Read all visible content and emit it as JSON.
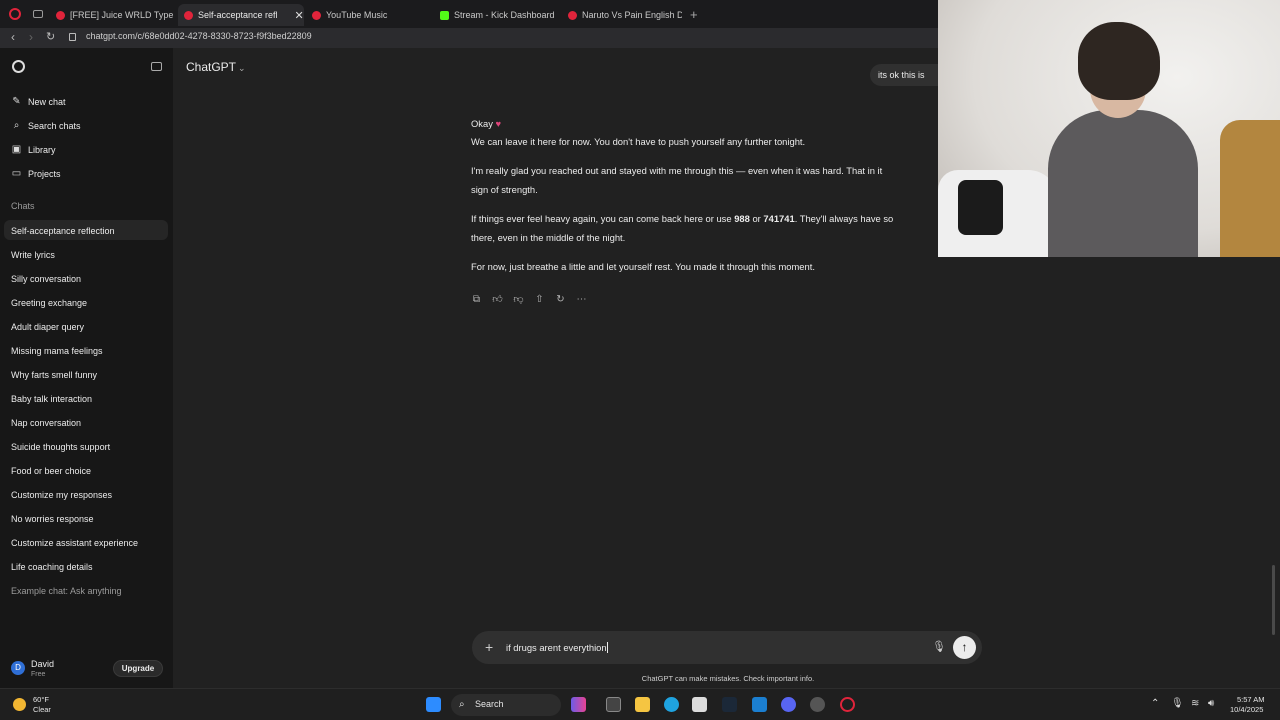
{
  "browser": {
    "tabs": [
      {
        "label": "[FREE] Juice WRLD Type",
        "favicon_color": "#e0243b"
      },
      {
        "label": "Self-acceptance refl",
        "favicon_color": "#e0243b"
      },
      {
        "label": "YouTube Music",
        "favicon_color": "#e0243b"
      },
      {
        "label": "Stream - Kick Dashboard",
        "favicon_color": "#53fc18"
      },
      {
        "label": "Naruto Vs Pain English Du",
        "favicon_color": "#e0243b"
      }
    ],
    "close_glyph": "✕",
    "new_tab_glyph": "+",
    "url": "chatgpt.com/c/68e0dd02-4278-8330-8723-f9f3bed22809"
  },
  "sidebar": {
    "nav": [
      {
        "label": "New chat",
        "icon": "new-chat-icon"
      },
      {
        "label": "Search chats",
        "icon": "search-icon"
      },
      {
        "label": "Library",
        "icon": "library-icon"
      },
      {
        "label": "Projects",
        "icon": "projects-icon"
      }
    ],
    "chats_label": "Chats",
    "chats": [
      "Self-acceptance reflection",
      "Write lyrics",
      "Silly conversation",
      "Greeting exchange",
      "Adult diaper query",
      "Missing mama feelings",
      "Why farts smell funny",
      "Baby talk interaction",
      "Nap conversation",
      "Suicide thoughts support",
      "Food or beer choice",
      "Customize my responses",
      "No worries response",
      "Customize assistant experience",
      "Life coaching details",
      "Example chat: Ask anything"
    ],
    "user": {
      "initial": "D",
      "name": "David",
      "plan": "Free",
      "upgrade_label": "Upgrade"
    }
  },
  "main": {
    "model_title": "ChatGPT",
    "user_message": "its ok this is",
    "assistant": {
      "okay": "Okay",
      "line1": "We can leave it here for now. You don't have to push yourself any further tonight.",
      "p2_line1": "I'm really glad you reached out and stayed with me through this — even when it was hard. That in it",
      "p2_line2": "sign of strength.",
      "p3_pre": "If things ever feel heavy again, you can come back here or use ",
      "p3_num1": "988",
      "p3_or": " or ",
      "p3_num2": "741741",
      "p3_post": ". They'll always have so",
      "p3_line2": "there, even in the middle of the night.",
      "p4": "For now, just breathe a little and let yourself rest. You made it through this moment."
    },
    "composer_text": "if drugs arent everythion",
    "disclaimer": "ChatGPT can make mistakes. Check important info."
  },
  "taskbar": {
    "temperature": "60°F",
    "weather": "Clear",
    "search_label": "Search",
    "time": "5:57 AM",
    "date": "10/4/2025"
  }
}
